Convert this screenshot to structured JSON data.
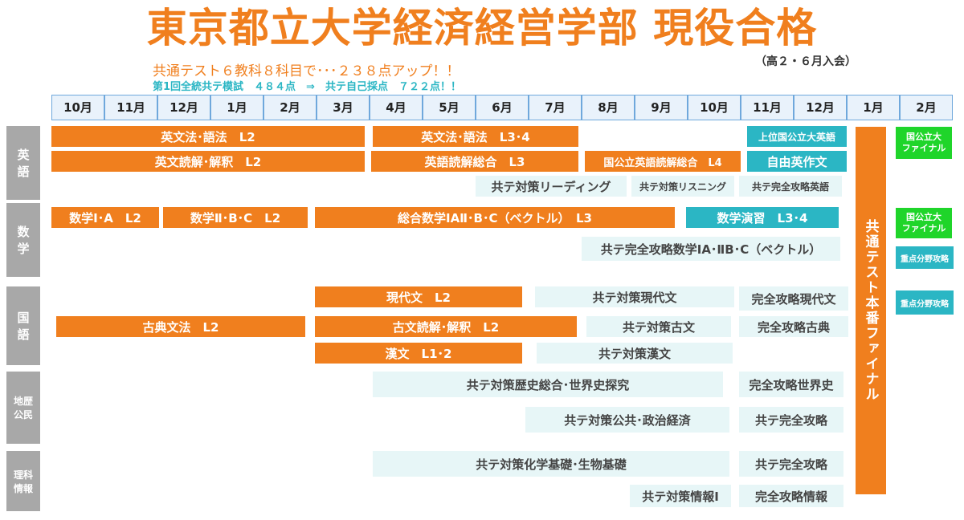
{
  "header": {
    "title": "東京都立大学経済経営学部 現役合格",
    "entry_note": "（高２・６月入会）",
    "subtitle": "共通テスト６教科８科目で･･･２３８点アップ！！",
    "score_line": "第1回全統共テ模試　４８４点　⇒　共テ自己採点　７２２点！！"
  },
  "months": [
    "10月",
    "11月",
    "12月",
    "1月",
    "2月",
    "3月",
    "4月",
    "5月",
    "6月",
    "7月",
    "8月",
    "9月",
    "10月",
    "11月",
    "12月",
    "1月",
    "2月"
  ],
  "subjects": {
    "english": "英\n語",
    "math": "数\n学",
    "japanese": "国\n語",
    "social": "地歴\n公民",
    "science": "理科\n情報"
  },
  "courses": {
    "eng_grammar_l2": "英文法･語法　L2",
    "eng_reading_l2": "英文読解･解釈　L2",
    "eng_grammar_l34": "英文法･語法　L3･4",
    "eng_reading_l3": "英語読解総合　L3",
    "eng_kokko_l4": "国公立英語読解総合　L4",
    "eng_top": "上位国公立大英語",
    "eng_writing": "自由英作文",
    "kyote_reading": "共テ対策リーディング",
    "kyote_listening": "共テ対策リスニング",
    "kyote_eng_full": "共テ完全攻略英語",
    "math_1a_l2": "数学Ⅰ･A　L2",
    "math_2bc_l2": "数学Ⅱ･B･C　L2",
    "math_sogo_l3": "総合数学ⅠAⅡ･B･C（ベクトル）　L3",
    "math_ensyu": "数学演習　L3･4",
    "math_kyote_full": "共テ完全攻略数学ⅠA･ⅡB･C（ベクトル）",
    "gendai_l2": "現代文　L2",
    "kyote_gendai": "共テ対策現代文",
    "full_gendai": "完全攻略現代文",
    "koten_grammar_l2": "古典文法　L2",
    "koten_reading_l2": "古文読解･解釈　L2",
    "kyote_kobun": "共テ対策古文",
    "full_koten": "完全攻略古典",
    "kanbun": "漢文　L1･2",
    "kyote_kanbun": "共テ対策漢文",
    "kyote_history": "共テ対策歴史総合･世界史探究",
    "full_world_history": "完全攻略世界史",
    "kyote_civics": "共テ対策公共･政治経済",
    "kyote_full_social": "共テ完全攻略",
    "kyote_chem_bio": "共テ対策化学基礎･生物基礎",
    "kyote_full_science": "共テ完全攻略",
    "kyote_info": "共テ対策情報Ⅰ",
    "full_info": "完全攻略情報",
    "final": "共通テスト本番ファイナル",
    "kokko_final_eng": "国公立大\nファイナル",
    "kokko_final_math": "国公立大\nファイナル",
    "juten_math": "重点分野攻略",
    "juten_japanese": "重点分野攻略"
  },
  "colors": {
    "orange": "#f07f1e",
    "teal": "#2bb6c4",
    "light_teal": "#e7f6f7",
    "green": "#1fd52a",
    "gray": "#a8a8a8"
  }
}
